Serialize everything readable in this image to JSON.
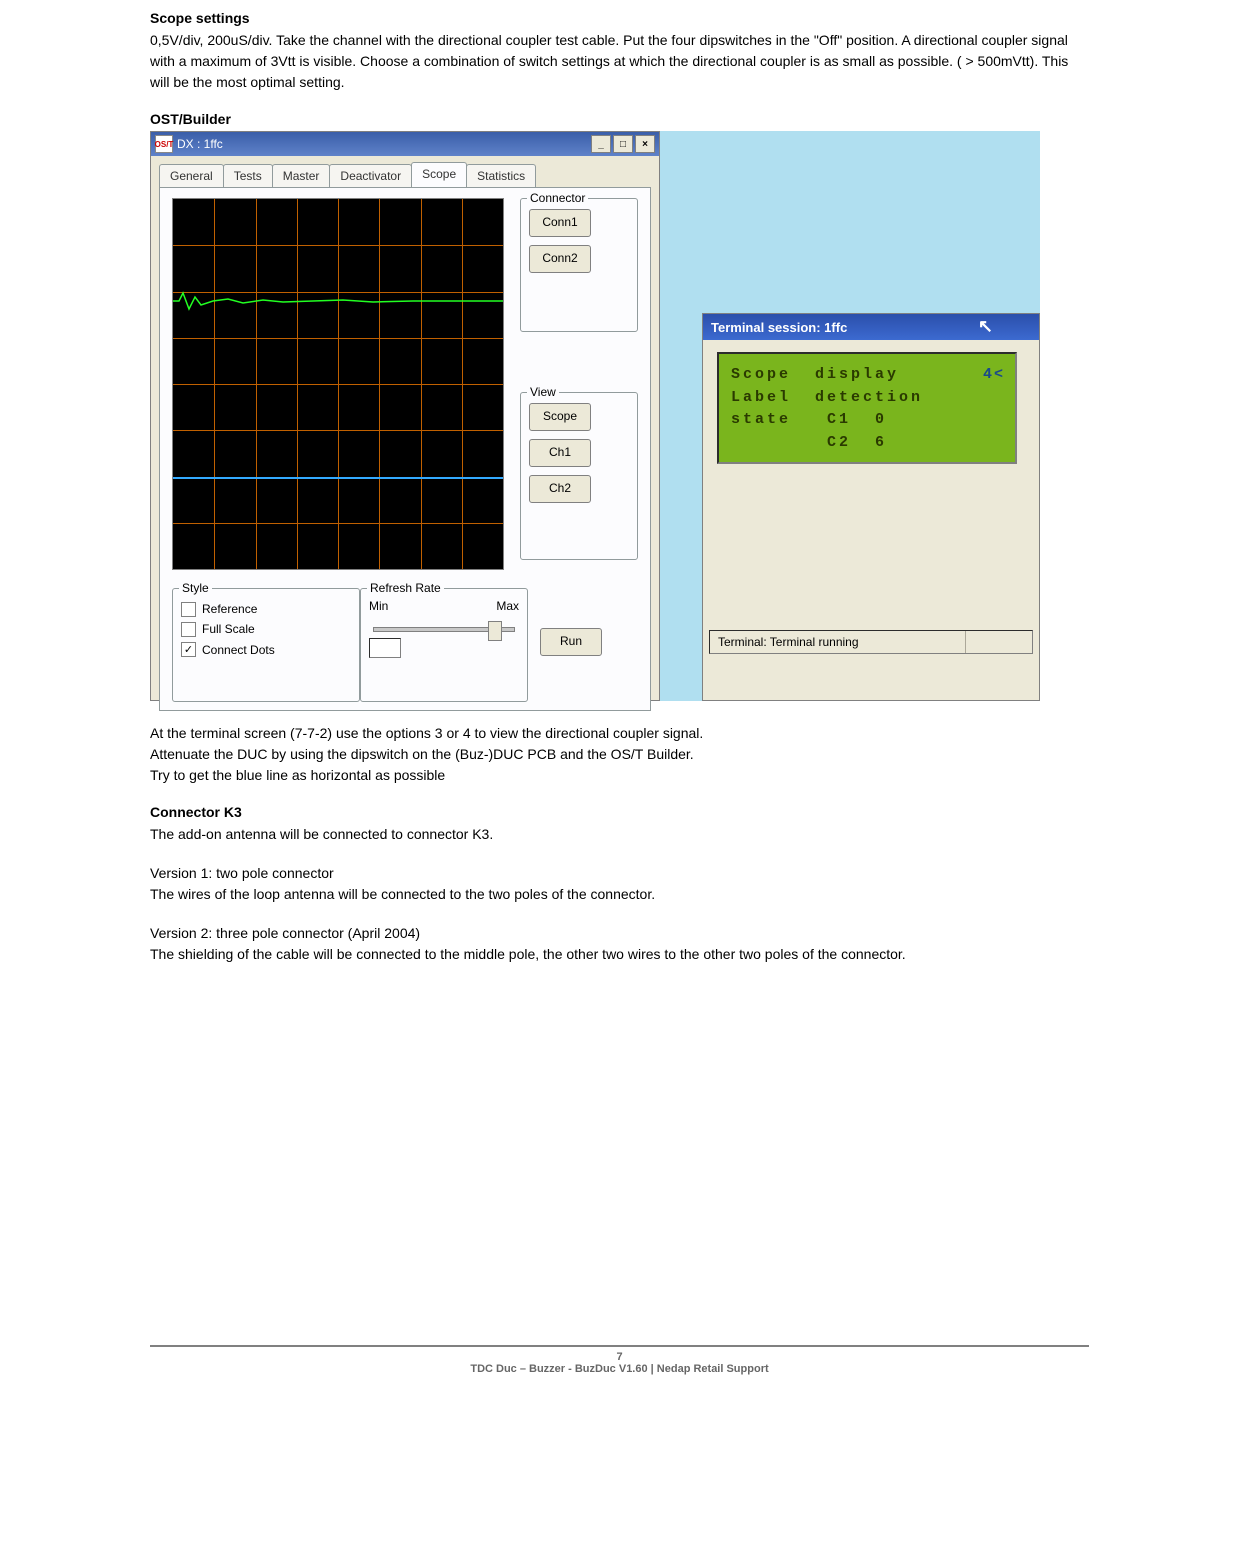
{
  "headings": {
    "scope_settings": "Scope settings",
    "ost_builder": "OST/Builder",
    "connector_k3": "Connector K3"
  },
  "paragraphs": {
    "scope_settings_body": "0,5V/div, 200uS/div. Take the channel with the directional coupler test cable. Put the four dipswitches in the \"Off\" position. A directional coupler signal with a maximum of 3Vtt is visible. Choose a combination of switch settings at which the directional coupler is as small as possible. ( > 500mVtt). This will be the most optimal setting.",
    "after_screenshot_1": "At the terminal screen (7-7-2) use the options 3 or 4 to view the directional coupler signal.",
    "after_screenshot_2": "Attenuate the DUC by using the dipswitch on the (Buz-)DUC PCB and the OS/T Builder.",
    "after_screenshot_3": "Try to get the blue line as horizontal as possible",
    "connector_k3_body": "The add-on antenna will be connected to connector K3.",
    "version1_title": "Version 1: two pole connector",
    "version1_body": "The wires of the loop antenna will be connected to the two poles of the connector.",
    "version2_title": "Version 2: three pole connector (April 2004)",
    "version2_body": "The shielding of the cable will be connected to the middle pole, the other two wires to the other two poles of the connector."
  },
  "left_window": {
    "title": "DX : 1ffc",
    "icon_label": "OS/T",
    "win_min": "_",
    "win_max": "□",
    "win_close": "×",
    "tabs": [
      "General",
      "Tests",
      "Master",
      "Deactivator",
      "Scope",
      "Statistics"
    ],
    "active_tab": "Scope",
    "connector": {
      "legend": "Connector",
      "buttons": [
        "Conn1",
        "Conn2"
      ]
    },
    "view": {
      "legend": "View",
      "buttons": [
        "Scope",
        "Ch1",
        "Ch2"
      ]
    },
    "style": {
      "legend": "Style",
      "options": [
        {
          "label": "Reference",
          "checked": false
        },
        {
          "label": "Full Scale",
          "checked": false
        },
        {
          "label": "Connect Dots",
          "checked": true
        }
      ]
    },
    "refresh": {
      "legend": "Refresh Rate",
      "min": "Min",
      "max": "Max"
    },
    "run": "Run"
  },
  "right_window": {
    "title": "Terminal session:  1ffc",
    "display_lines": [
      "Scope  display",
      "Label  detection",
      "state   C1  0",
      "        C2  6"
    ],
    "top_right": "4<",
    "status": "Terminal: Terminal running"
  },
  "footer": {
    "page": "7",
    "line": "TDC Duc – Buzzer - BuzDuc V1.60 | Nedap Retail Support"
  }
}
